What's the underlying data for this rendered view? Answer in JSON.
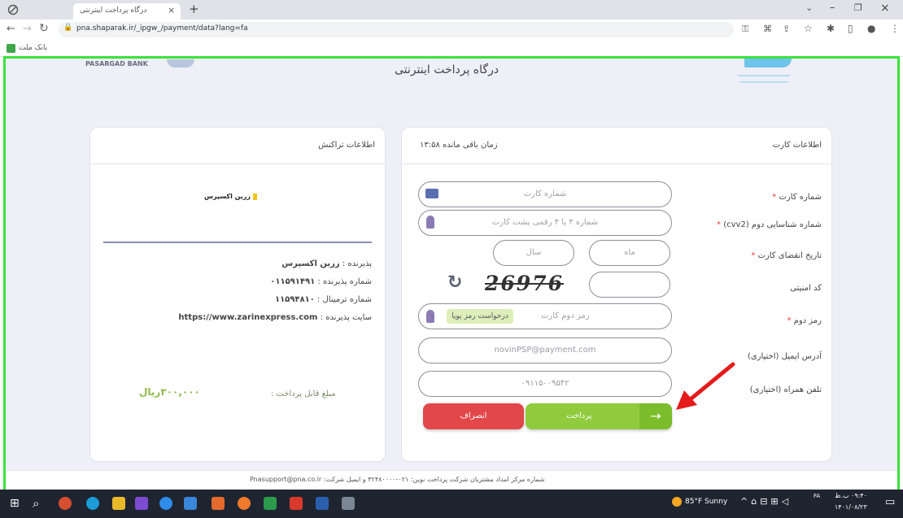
{
  "browser": {
    "tab_title": "درگاه پرداخت اینترنتی",
    "address": "pna.shaparak.ir/_ipgw_/payment/data?lang=fa",
    "bookmark": "بانک ملت"
  },
  "page": {
    "left_brand": "PASARGAD BANK",
    "title": "درگاه پرداخت اینترنتی"
  },
  "card_panel": {
    "header": "اطلاعات کارت",
    "timer": "زمان باقی مانده ۱۳:۵۸",
    "labels": {
      "card_number": "شماره کارت",
      "cvv2": "شماره شناسایی دوم (cvv2)",
      "expiry": "تاریخ انقضای کارت",
      "captcha": "کد امنیتی",
      "pin2": "رمز دوم",
      "email": "آدرس ایمیل (اختیاری)",
      "mobile": "تلفن همراه (اختیاری)"
    },
    "required_mark": "*",
    "placeholders": {
      "card_number": "شماره کارت",
      "cvv2": "شماره ۳ یا ۴ رقمی پشت کارت",
      "month": "ماه",
      "year": "سال",
      "pin2": "رمز دوم کارت"
    },
    "captcha_text": "26976",
    "otp_button": "درخواست رمز پویا",
    "email_value": "novinPSP@payment.com",
    "mobile_value": "۰۹۱۱۵۰۰۹۵۴۲",
    "pay_button": "پرداخت",
    "cancel_button": "انصراف"
  },
  "tx_panel": {
    "header": "اطلاعات تراکنش",
    "merchant_logo": "زرین اکسپرس",
    "rows": [
      {
        "label": "پذیرنده :",
        "value": "زرین اکسپرس"
      },
      {
        "label": "شماره پذیرنده :",
        "value": "۰۱۱۵۹۱۴۹۱"
      },
      {
        "label": "شماره ترمینال :",
        "value": "۱۱۵۹۴۸۱۰"
      },
      {
        "label": "سایت پذیرنده :",
        "value": "https://www.zarinexpress.com"
      }
    ],
    "amount_label": "مبلغ قابل پرداخت :",
    "amount_value": "۳۰۰,۰۰۰ریال"
  },
  "footer": {
    "text": "شماره مرکز امداد مشتریان شرکت پرداخت نوین: ۰۲۱-۴۲۴۸۰۰۰۰ و ایمیل شرکت: Pnasupport@pna.co.ir"
  },
  "taskbar": {
    "weather": "85°F Sunny",
    "lang": "FA",
    "time": "۰۹:۴۰ ب.ظ",
    "date": "۱۴۰۱/۰۸/۲۳"
  },
  "colors": {
    "highlight_border": "#3be23b",
    "pay": "#8fcb3d",
    "cancel": "#e2474a",
    "arrow": "#e51b1b"
  }
}
